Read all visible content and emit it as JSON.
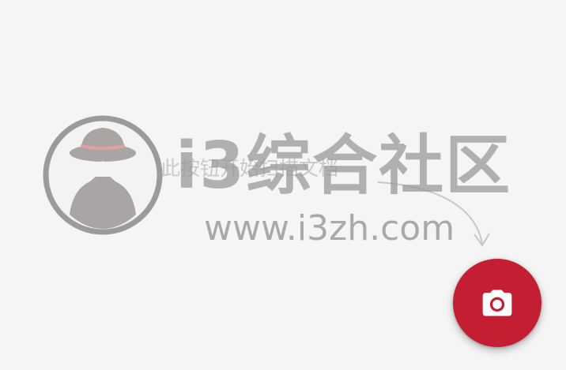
{
  "hint": {
    "text": "按此按钮开始扫描文档"
  },
  "watermark": {
    "title": "i3综合社区",
    "url": "www.i3zh.com"
  },
  "fab": {
    "icon": "camera-icon",
    "color": "#c41e32"
  }
}
